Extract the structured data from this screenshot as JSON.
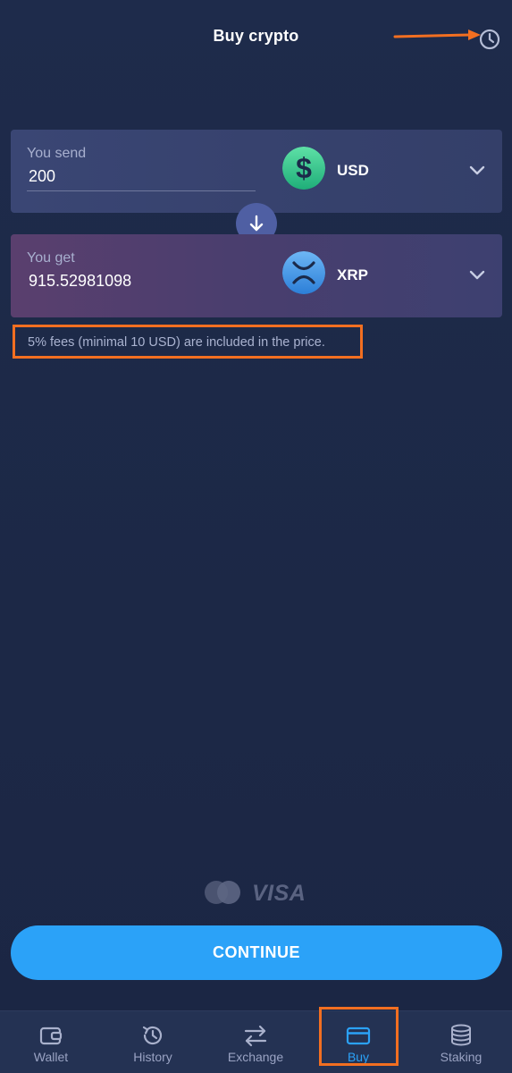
{
  "header": {
    "title": "Buy crypto",
    "history_icon": "history-icon"
  },
  "send": {
    "label": "You send",
    "value": "200",
    "currency_code": "USD",
    "currency_icon": "dollar-coin-icon"
  },
  "get": {
    "label": "You get",
    "value": "915.52981098",
    "currency_code": "XRP",
    "currency_icon": "xrp-coin-icon"
  },
  "fees_note": "5% fees (minimal 10 USD) are included in the price.",
  "payment_methods": {
    "visa_text": "VISA",
    "icons": [
      "mastercard-icon",
      "visa-icon"
    ]
  },
  "continue_label": "CONTINUE",
  "nav": {
    "items": [
      {
        "label": "Wallet",
        "icon": "wallet-icon",
        "active": false
      },
      {
        "label": "History",
        "icon": "history-icon",
        "active": false
      },
      {
        "label": "Exchange",
        "icon": "exchange-icon",
        "active": false
      },
      {
        "label": "Buy",
        "icon": "card-icon",
        "active": true
      },
      {
        "label": "Staking",
        "icon": "staking-icon",
        "active": false
      }
    ]
  },
  "colors": {
    "background": "#1d2a4a",
    "accent": "#2ba2f8",
    "annotation": "#f26f21",
    "usd_coin": "#35c28b",
    "xrp_coin": "#3d8fe0"
  }
}
